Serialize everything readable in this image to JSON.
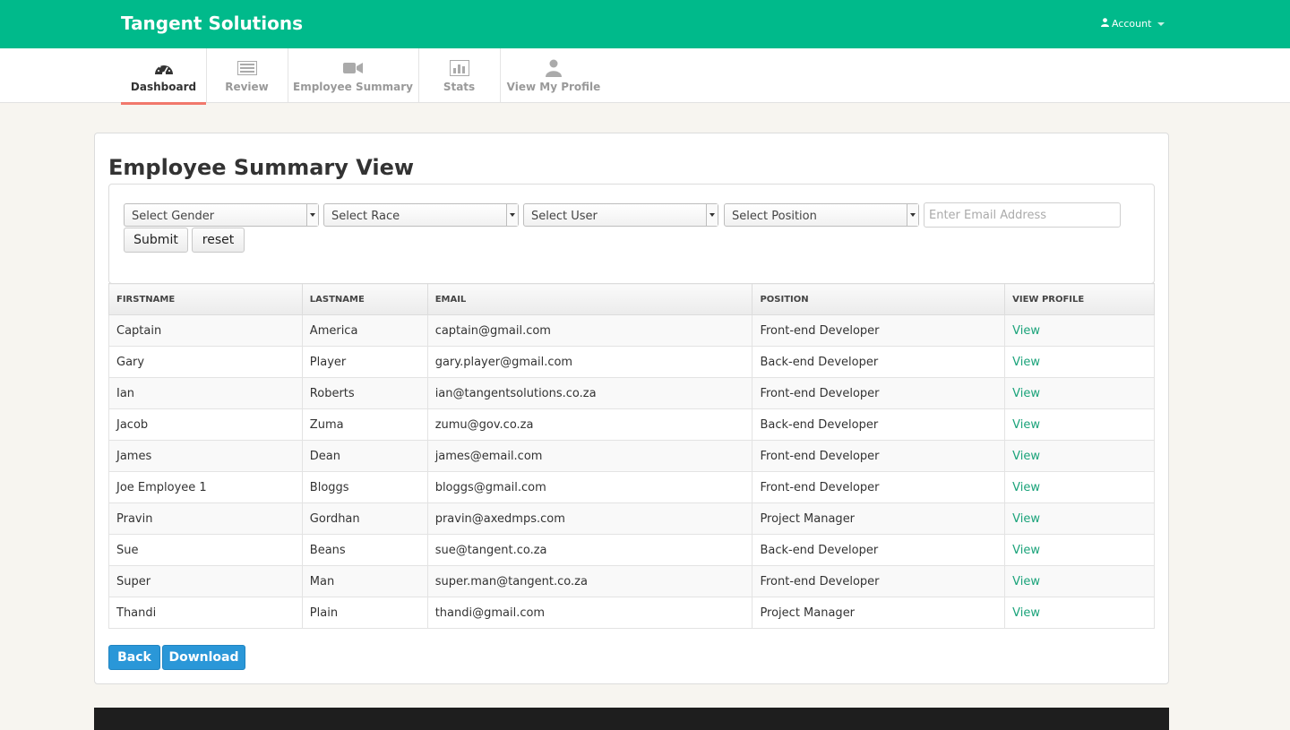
{
  "app": {
    "brand": "Tangent Solutions",
    "account_label": "Account"
  },
  "nav": {
    "tabs": [
      {
        "label": "Dashboard",
        "icon": "dashboard-gauge-icon",
        "active": true
      },
      {
        "label": "Review",
        "icon": "list-review-icon",
        "active": false
      },
      {
        "label": "Employee Summary",
        "icon": "video-camera-icon",
        "active": false
      },
      {
        "label": "Stats",
        "icon": "bar-chart-icon",
        "active": false
      },
      {
        "label": "View My Profile",
        "icon": "user-icon",
        "active": false
      }
    ]
  },
  "page": {
    "title": "Employee Summary View"
  },
  "filters": {
    "gender": "Select Gender",
    "race": "Select Race",
    "user": "Select User",
    "position": "Select Position",
    "email_placeholder": "Enter Email Address",
    "submit": "Submit",
    "reset": "reset"
  },
  "table": {
    "headers": [
      "FIRSTNAME",
      "LASTNAME",
      "EMAIL",
      "POSITION",
      "VIEW PROFILE"
    ],
    "link_label": "View",
    "rows": [
      [
        "Captain",
        "America",
        "captain@gmail.com",
        "Front-end Developer"
      ],
      [
        "Gary",
        "Player",
        "gary.player@gmail.com",
        "Back-end Developer"
      ],
      [
        "Ian",
        "Roberts",
        "ian@tangentsolutions.co.za",
        "Front-end Developer"
      ],
      [
        "Jacob",
        "Zuma",
        "zumu@gov.co.za",
        "Back-end Developer"
      ],
      [
        "James",
        "Dean",
        "james@email.com",
        "Front-end Developer"
      ],
      [
        "Joe Employee 1",
        "Bloggs",
        "bloggs@gmail.com",
        "Front-end Developer"
      ],
      [
        "Pravin",
        "Gordhan",
        "pravin@axedmps.com",
        "Project Manager"
      ],
      [
        "Sue",
        "Beans",
        "sue@tangent.co.za",
        "Back-end Developer"
      ],
      [
        "Super",
        "Man",
        "super.man@tangent.co.za",
        "Front-end Developer"
      ],
      [
        "Thandi",
        "Plain",
        "thandi@gmail.com",
        "Project Manager"
      ]
    ]
  },
  "actions": {
    "back": "Back",
    "download": "Download"
  },
  "colors": {
    "brand_green": "#00ba8b",
    "active_tab_underline": "#f1786b",
    "primary_blue": "#2a97d8",
    "link_green": "#1aa37a"
  }
}
